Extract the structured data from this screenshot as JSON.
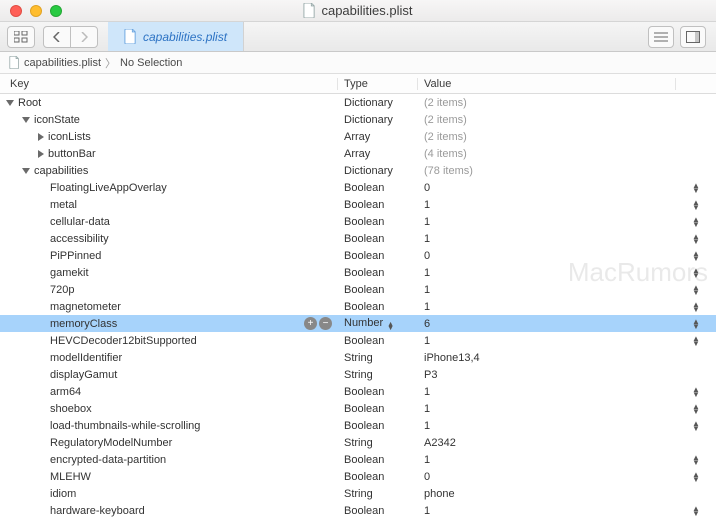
{
  "window": {
    "title": "capabilities.plist"
  },
  "toolbar": {
    "tab_label": "capabilities.plist"
  },
  "breadcrumb": {
    "file": "capabilities.plist",
    "selection": "No Selection"
  },
  "columns": {
    "key": "Key",
    "type": "Type",
    "value": "Value"
  },
  "rows": [
    {
      "indent": 0,
      "disclosure": "open",
      "key": "Root",
      "type": "Dictionary",
      "value": "(2 items)",
      "value_muted": true,
      "stepper": false
    },
    {
      "indent": 1,
      "disclosure": "open",
      "key": "iconState",
      "type": "Dictionary",
      "value": "(2 items)",
      "value_muted": true,
      "stepper": false
    },
    {
      "indent": 2,
      "disclosure": "closed",
      "key": "iconLists",
      "type": "Array",
      "value": "(2 items)",
      "value_muted": true,
      "stepper": false
    },
    {
      "indent": 2,
      "disclosure": "closed",
      "key": "buttonBar",
      "type": "Array",
      "value": "(4 items)",
      "value_muted": true,
      "stepper": false
    },
    {
      "indent": 1,
      "disclosure": "open",
      "key": "capabilities",
      "type": "Dictionary",
      "value": "(78 items)",
      "value_muted": true,
      "stepper": false
    },
    {
      "indent": 2,
      "disclosure": "none",
      "key": "FloatingLiveAppOverlay",
      "type": "Boolean",
      "value": "0",
      "value_muted": false,
      "stepper": true
    },
    {
      "indent": 2,
      "disclosure": "none",
      "key": "metal",
      "type": "Boolean",
      "value": "1",
      "value_muted": false,
      "stepper": true
    },
    {
      "indent": 2,
      "disclosure": "none",
      "key": "cellular-data",
      "type": "Boolean",
      "value": "1",
      "value_muted": false,
      "stepper": true
    },
    {
      "indent": 2,
      "disclosure": "none",
      "key": "accessibility",
      "type": "Boolean",
      "value": "1",
      "value_muted": false,
      "stepper": true
    },
    {
      "indent": 2,
      "disclosure": "none",
      "key": "PiPPinned",
      "type": "Boolean",
      "value": "0",
      "value_muted": false,
      "stepper": true
    },
    {
      "indent": 2,
      "disclosure": "none",
      "key": "gamekit",
      "type": "Boolean",
      "value": "1",
      "value_muted": false,
      "stepper": true
    },
    {
      "indent": 2,
      "disclosure": "none",
      "key": "720p",
      "type": "Boolean",
      "value": "1",
      "value_muted": false,
      "stepper": true
    },
    {
      "indent": 2,
      "disclosure": "none",
      "key": "magnetometer",
      "type": "Boolean",
      "value": "1",
      "value_muted": false,
      "stepper": true
    },
    {
      "indent": 2,
      "disclosure": "none",
      "key": "memoryClass",
      "type": "Number",
      "value": "6",
      "value_muted": false,
      "stepper": true,
      "selected": true,
      "show_rowbtns": true,
      "type_stepper": true
    },
    {
      "indent": 2,
      "disclosure": "none",
      "key": "HEVCDecoder12bitSupported",
      "type": "Boolean",
      "value": "1",
      "value_muted": false,
      "stepper": true
    },
    {
      "indent": 2,
      "disclosure": "none",
      "key": "modelIdentifier",
      "type": "String",
      "value": "iPhone13,4",
      "value_muted": false,
      "stepper": false
    },
    {
      "indent": 2,
      "disclosure": "none",
      "key": "displayGamut",
      "type": "String",
      "value": "P3",
      "value_muted": false,
      "stepper": false
    },
    {
      "indent": 2,
      "disclosure": "none",
      "key": "arm64",
      "type": "Boolean",
      "value": "1",
      "value_muted": false,
      "stepper": true
    },
    {
      "indent": 2,
      "disclosure": "none",
      "key": "shoebox",
      "type": "Boolean",
      "value": "1",
      "value_muted": false,
      "stepper": true
    },
    {
      "indent": 2,
      "disclosure": "none",
      "key": "load-thumbnails-while-scrolling",
      "type": "Boolean",
      "value": "1",
      "value_muted": false,
      "stepper": true
    },
    {
      "indent": 2,
      "disclosure": "none",
      "key": "RegulatoryModelNumber",
      "type": "String",
      "value": "A2342",
      "value_muted": false,
      "stepper": false
    },
    {
      "indent": 2,
      "disclosure": "none",
      "key": "encrypted-data-partition",
      "type": "Boolean",
      "value": "1",
      "value_muted": false,
      "stepper": true
    },
    {
      "indent": 2,
      "disclosure": "none",
      "key": "MLEHW",
      "type": "Boolean",
      "value": "0",
      "value_muted": false,
      "stepper": true
    },
    {
      "indent": 2,
      "disclosure": "none",
      "key": "idiom",
      "type": "String",
      "value": "phone",
      "value_muted": false,
      "stepper": false
    },
    {
      "indent": 2,
      "disclosure": "none",
      "key": "hardware-keyboard",
      "type": "Boolean",
      "value": "1",
      "value_muted": false,
      "stepper": true
    }
  ],
  "watermark": "MacRumors"
}
